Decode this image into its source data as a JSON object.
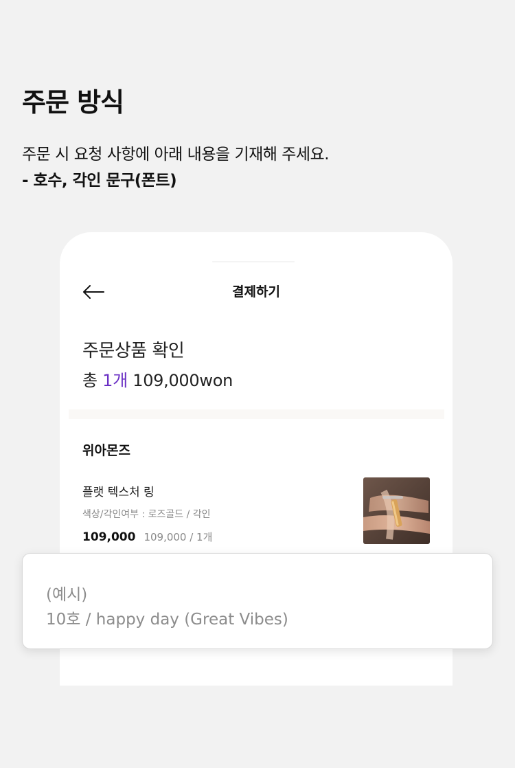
{
  "section": {
    "title": "주문 방식",
    "description": "주문 시 요청 사항에 아래 내용을 기재해 주세요.",
    "bullet": "-  호수, 각인 문구(폰트)"
  },
  "screen": {
    "title": "결제하기",
    "back_icon": "arrow-left-icon",
    "confirm_title": "주문상품 확인",
    "summary_prefix": "총",
    "summary_count": "1개",
    "summary_total": "109,000won",
    "accent_color": "#6a2fc4"
  },
  "order": {
    "brand": "위아몬즈",
    "product_name": "플랫 텍스처 링",
    "option": "색상/각인여부 : 로즈골드 / 각인",
    "price": "109,000",
    "price_detail": "109,000 / 1개",
    "thumbnail_icon": "ring-on-finger-photo"
  },
  "example": {
    "label": "(예시)",
    "value": "10호 / happy day (Great Vibes)"
  }
}
